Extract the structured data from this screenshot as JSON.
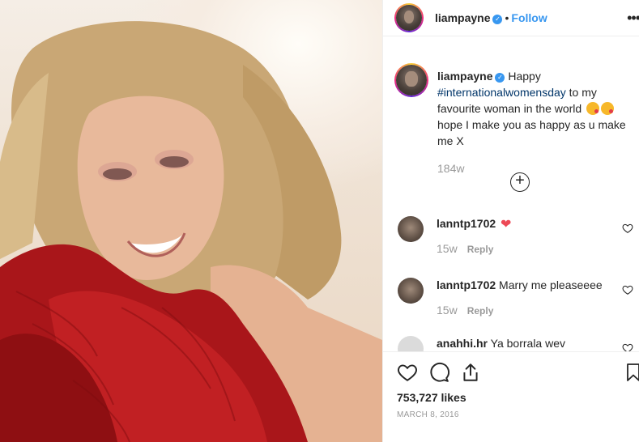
{
  "post": {
    "username": "liampayne",
    "follow_label": "Follow",
    "more_label": "•••"
  },
  "caption": {
    "username": "liampayne",
    "text_before": "Happy",
    "hashtag": "#internationalwomensday",
    "text_after": "to my favourite woman in the world",
    "text_end": "hope I make you as happy as u make me X",
    "time": "184w"
  },
  "comments": [
    {
      "username": "lanntp1702",
      "text": "",
      "time": "15w",
      "reply_label": "Reply",
      "has_heart_emoji": true
    },
    {
      "username": "lanntp1702",
      "text": "Marry me pleaseeee",
      "time": "15w",
      "reply_label": "Reply"
    },
    {
      "username": "anahhi.hr",
      "text": "Ya borrala wev"
    }
  ],
  "footer": {
    "likes": "753,727 likes",
    "date": "MARCH 8, 2016"
  },
  "icons": {
    "load_more": "add-circle-icon",
    "like": "heart-icon",
    "comment": "comment-icon",
    "share": "share-icon",
    "save": "bookmark-icon"
  },
  "colors": {
    "link_blue": "#3897f0",
    "hashtag_blue": "#003569",
    "heart_red": "#ed4956",
    "muted_text": "#999999"
  }
}
